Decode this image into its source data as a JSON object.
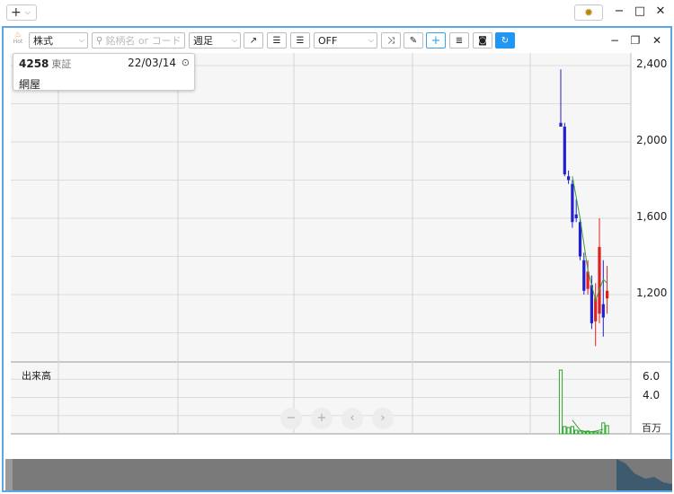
{
  "titlebar": {
    "add_label": "+",
    "settings_icon": "gear-icon"
  },
  "toolbar": {
    "hot_label": "Hot",
    "market_type": "株式",
    "search_placeholder": "銘柄名 or コード",
    "period": "週足",
    "indicator": "OFF"
  },
  "info": {
    "code": "4258",
    "market": "東証",
    "date": "22/03/14",
    "name": "網屋"
  },
  "price_axis": {
    "ticks": [
      "2,400",
      "2,000",
      "1,600",
      "1,200"
    ]
  },
  "volume": {
    "label": "出来高",
    "ticks": [
      "6.0",
      "4.0"
    ],
    "unit": "百万"
  },
  "nav": {
    "zoom_out": "−",
    "zoom_in": "+",
    "prev": "‹",
    "next": "›"
  },
  "chart_data": {
    "type": "candlestick",
    "y_ticks": [
      2400,
      2000,
      1600,
      1200
    ],
    "ylim": [
      900,
      2450
    ],
    "volume_ylim": [
      0,
      7.5
    ],
    "volume_unit": "百万",
    "candles": [
      {
        "o": 2100,
        "h": 2380,
        "l": 2080,
        "c": 2080,
        "dir": "down",
        "vol": 7.0
      },
      {
        "o": 2080,
        "h": 2100,
        "l": 1820,
        "c": 1830,
        "dir": "down",
        "vol": 0.8
      },
      {
        "o": 1820,
        "h": 1850,
        "l": 1780,
        "c": 1800,
        "dir": "down",
        "vol": 0.7
      },
      {
        "o": 1780,
        "h": 1800,
        "l": 1550,
        "c": 1580,
        "dir": "down",
        "vol": 0.8
      },
      {
        "o": 1620,
        "h": 1700,
        "l": 1580,
        "c": 1600,
        "dir": "down",
        "vol": 0.4
      },
      {
        "o": 1580,
        "h": 1600,
        "l": 1380,
        "c": 1400,
        "dir": "down",
        "vol": 0.3
      },
      {
        "o": 1380,
        "h": 1420,
        "l": 1200,
        "c": 1220,
        "dir": "down",
        "vol": 0.2
      },
      {
        "o": 1230,
        "h": 1380,
        "l": 1200,
        "c": 1320,
        "dir": "up",
        "vol": 0.3
      },
      {
        "o": 1250,
        "h": 1300,
        "l": 1020,
        "c": 1050,
        "dir": "down",
        "vol": 0.2
      },
      {
        "o": 1060,
        "h": 1260,
        "l": 930,
        "c": 1180,
        "dir": "up",
        "vol": 0.2
      },
      {
        "o": 1100,
        "h": 1600,
        "l": 1050,
        "c": 1450,
        "dir": "up",
        "vol": 0.2
      },
      {
        "o": 1150,
        "h": 1380,
        "l": 980,
        "c": 1080,
        "dir": "down",
        "vol": 1.2
      },
      {
        "o": 1180,
        "h": 1350,
        "l": 1100,
        "c": 1220,
        "dir": "up",
        "vol": 0.9
      }
    ],
    "ma": [
      [
        3,
        1820
      ],
      [
        5,
        1600
      ],
      [
        7,
        1330
      ],
      [
        9,
        1170
      ],
      [
        11,
        1280
      ],
      [
        12,
        1260
      ]
    ],
    "volume_ma": [
      [
        3,
        1.5
      ],
      [
        5,
        0.4
      ],
      [
        7,
        0.2
      ],
      [
        9,
        0.3
      ],
      [
        11,
        0.5
      ]
    ]
  }
}
